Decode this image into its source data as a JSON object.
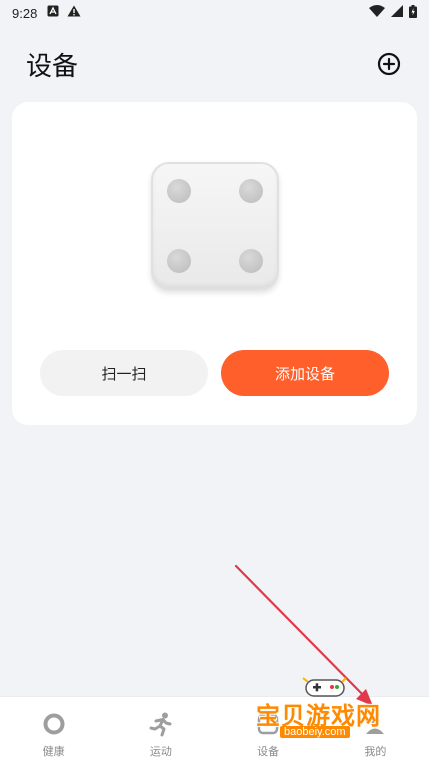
{
  "status_bar": {
    "time": "9:28"
  },
  "header": {
    "title": "设备"
  },
  "device_card": {
    "scan_label": "扫一扫",
    "add_device_label": "添加设备"
  },
  "bottom_nav": {
    "items": [
      {
        "label": "健康",
        "icon": "health-ring-icon"
      },
      {
        "label": "运动",
        "icon": "running-icon"
      },
      {
        "label": "设备",
        "icon": "device-icon"
      },
      {
        "label": "我的",
        "icon": "profile-icon"
      }
    ]
  },
  "watermark": {
    "title": "宝贝游戏网",
    "url": "baobeiy.com"
  },
  "colors": {
    "accent": "#ff5f2a",
    "background": "#f2f3f7",
    "card": "#ffffff",
    "annotation_arrow": "#e0394a"
  }
}
